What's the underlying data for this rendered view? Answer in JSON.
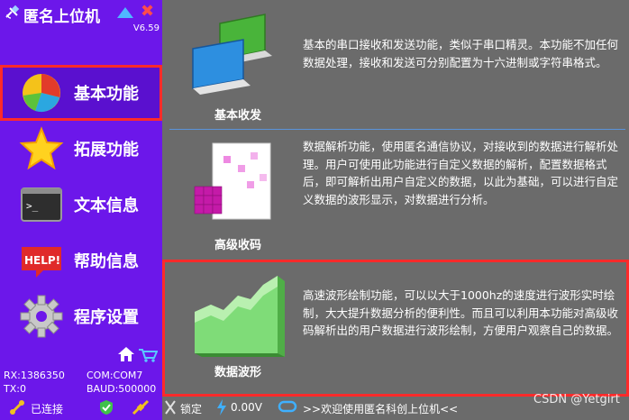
{
  "app": {
    "title": "匿名上位机",
    "version": "V6.59"
  },
  "nav": [
    {
      "label": "基本功能",
      "icon": "pie-chart-icon",
      "active": true
    },
    {
      "label": "拓展功能",
      "icon": "star-icon"
    },
    {
      "label": "文本信息",
      "icon": "terminal-icon"
    },
    {
      "label": "帮助信息",
      "icon": "help-icon",
      "badge": "HELP!"
    },
    {
      "label": "程序设置",
      "icon": "gear-icon"
    }
  ],
  "stats": {
    "rx": "RX:1386350",
    "tx": "TX:0",
    "com": "COM:COM7",
    "baud": "BAUD:500000"
  },
  "cards": [
    {
      "title": "基本收发",
      "icon": "monitors-icon",
      "desc": "基本的串口接收和发送功能，类似于串口精灵。本功能不加任何数据处理，接收和发送可分别配置为十六进制或字符串格式。"
    },
    {
      "title": "高级收码",
      "icon": "data-cubes-icon",
      "desc": "数据解析功能，使用匿名通信协议，对接收到的数据进行解析处理。用户可使用此功能进行自定义数据的解析，配置数据格式后，即可解析出用户自定义的数据，以此为基础，可以进行自定义数据的波形显示，对数据进行分析。"
    },
    {
      "title": "数据波形",
      "icon": "area-chart-icon",
      "active": true,
      "desc": "高速波形绘制功能，可以以大于1000hz的速度进行波形实时绘制，大大提升数据分析的便利性。而且可以利用本功能对高级收码解析出的用户数据进行波形绘制，方便用户观察自己的数据。"
    }
  ],
  "status": {
    "connected": "已连接",
    "lock": "锁定",
    "voltage": "0.00V",
    "welcome": ">>欢迎使用匿名科创上位机<<"
  },
  "watermark": "CSDN @Yetgirt",
  "colors": {
    "sidebar": "#6c17ea",
    "content": "#6b6b6b",
    "highlight": "#ff2a2a"
  }
}
